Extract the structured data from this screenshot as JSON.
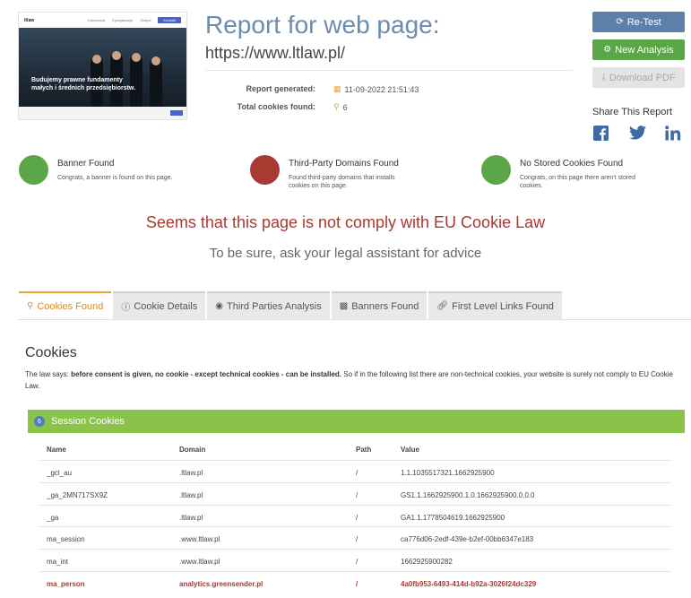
{
  "thumbnail": {
    "logo": "ltlaw",
    "nav": [
      "Kancelaria",
      "Specjalizacje",
      "Zespół",
      "Kontakt"
    ],
    "hero_text_line1": "Budujemy prawne fundamenty",
    "hero_text_line2": "małych i średnich przedsiębiorstw."
  },
  "header": {
    "title": "Report for web page:",
    "url": "https://www.ltlaw.pl/",
    "report_generated_label": "Report generated:",
    "report_generated_value": "11-09-2022 21:51:43",
    "total_cookies_label": "Total cookies found:",
    "total_cookies_value": "6",
    "calendar_icon": "calendar-icon",
    "search_icon": "search-icon"
  },
  "actions": {
    "retest": "Re-Test",
    "new_analysis": "New Analysis",
    "download_pdf": "Download PDF",
    "share_label": "Share This Report",
    "share": [
      "facebook-icon",
      "twitter-icon",
      "linkedin-icon"
    ]
  },
  "statuses": [
    {
      "title": "Banner Found",
      "desc": "Congrats, a banner is found on this page.",
      "color": "#5aa748"
    },
    {
      "title": "Third-Party Domains Found",
      "desc": "Found third-party domains that installs cookies on this page.",
      "color": "#a83a32"
    },
    {
      "title": "No Stored Cookies Found",
      "desc": "Congrats, on this page there aren't stored cookies.",
      "color": "#5aa748"
    }
  ],
  "verdict": {
    "warning": "Seems that this page is not comply with EU Cookie Law",
    "advice": "To be sure, ask your legal assistant for advice"
  },
  "tabs": [
    {
      "label": "Cookies Found",
      "icon": "search-icon",
      "active": true
    },
    {
      "label": "Cookie Details",
      "icon": "info-icon",
      "active": false
    },
    {
      "label": "Third Parties Analysis",
      "icon": "globe-icon",
      "active": false
    },
    {
      "label": "Banners Found",
      "icon": "banner-icon",
      "active": false
    },
    {
      "label": "First Level Links Found",
      "icon": "link-icon",
      "active": false
    }
  ],
  "cookies": {
    "heading": "Cookies",
    "law_prefix": "The law says: ",
    "law_bold": "before consent is given, no cookie - except technical cookies - can be installed.",
    "law_suffix": " So if in the following list there are non-technical cookies, your website is surely not comply to EU Cookie Law.",
    "session": {
      "count": "6",
      "label": "Session Cookies"
    },
    "columns": [
      "Name",
      "Domain",
      "Path",
      "Value"
    ],
    "rows": [
      {
        "name": "_gcl_au",
        "domain": ".ltlaw.pl",
        "path": "/",
        "value": "1.1.1035517321.1662925900",
        "third_party": false
      },
      {
        "name": "_ga_2MN717SX9Z",
        "domain": ".ltlaw.pl",
        "path": "/",
        "value": "GS1.1.1662925900.1.0.1662925900.0.0.0",
        "third_party": false
      },
      {
        "name": "_ga",
        "domain": ".ltlaw.pl",
        "path": "/",
        "value": "GA1.1.1778504619.1662925900",
        "third_party": false
      },
      {
        "name": "ma_session",
        "domain": ".www.ltlaw.pl",
        "path": "/",
        "value": "ca776d06-2edf-439e-b2ef-00bb6347e183",
        "third_party": false
      },
      {
        "name": "ma_int",
        "domain": ".www.ltlaw.pl",
        "path": "/",
        "value": "1662925900282",
        "third_party": false
      },
      {
        "name": "ma_person",
        "domain": "analytics.greensender.pl",
        "path": "/",
        "value": "4a0fb953-6493-414d-b92a-3026f24dc329",
        "third_party": true
      }
    ]
  }
}
